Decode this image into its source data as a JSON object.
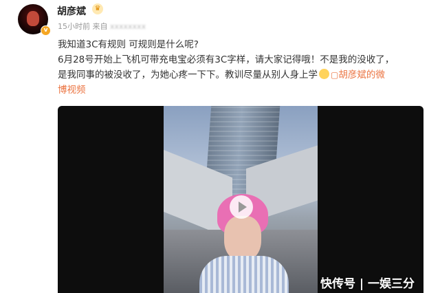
{
  "user": {
    "name": "胡彦斌",
    "timestamp": "15小时前",
    "source_prefix": "来自",
    "source": "xxxxxxxx"
  },
  "post": {
    "line1": "我知道3C有规则 可规则是什么呢?",
    "line2": "6月28号开始上飞机可带充电宝必须有3C字样，请大家记得哦！不是我的没收了，",
    "line3_text": "是我同事的被没收了，为她心疼一下下。教训尽量从别人身上学",
    "link_text": "胡彦斌的微",
    "line4": "博视频"
  },
  "watermark": "快传号 | 一娱三分",
  "colors": {
    "link": "#eb7340",
    "username": "#222222",
    "meta": "#999999"
  },
  "icons": [
    "verified-badge-icon",
    "crown-icon",
    "laugh-emoji-icon",
    "video-link-icon",
    "play-icon"
  ]
}
